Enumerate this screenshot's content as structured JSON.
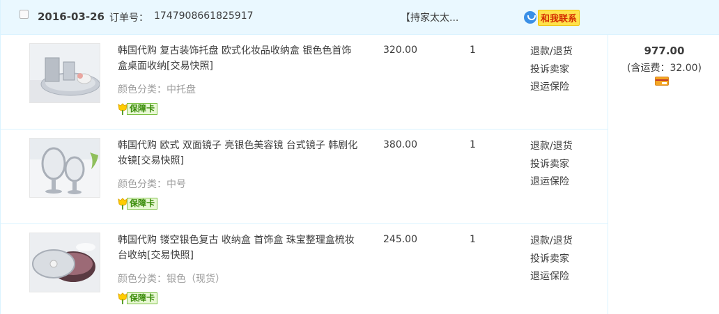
{
  "order": {
    "date": "2016-03-26",
    "order_no_label": "订单号：",
    "order_no": "1747908661825917",
    "shop_name": "【持家太太...",
    "contact_label": "和我联系",
    "total": "977.00",
    "shipping": "(含运费：32.00)"
  },
  "items": [
    {
      "title": "韩国代购 复古装饰托盘 欧式化妆品收纳盒 银色色首饰盒桌面收纳[交易快照]",
      "sku": "颜色分类：中托盘",
      "badge": "保障卡",
      "price": "320.00",
      "qty": "1",
      "op1": "退款/退货",
      "op2": "投诉卖家",
      "op3": "退运保险"
    },
    {
      "title": "韩国代购 欧式 双面镜子 亮银色美容镜 台式镜子 韩剧化妆镜[交易快照]",
      "sku": "颜色分类：中号",
      "badge": "保障卡",
      "price": "380.00",
      "qty": "1",
      "op1": "退款/退货",
      "op2": "投诉卖家",
      "op3": "退运保险"
    },
    {
      "title": "韩国代购 镂空银色复古 收纳盒 首饰盒 珠宝整理盒梳妆台收纳[交易快照]",
      "sku": "颜色分类：银色（现货）",
      "badge": "保障卡",
      "price": "245.00",
      "qty": "1",
      "op1": "退款/退货",
      "op2": "投诉卖家",
      "op3": "退运保险"
    }
  ]
}
